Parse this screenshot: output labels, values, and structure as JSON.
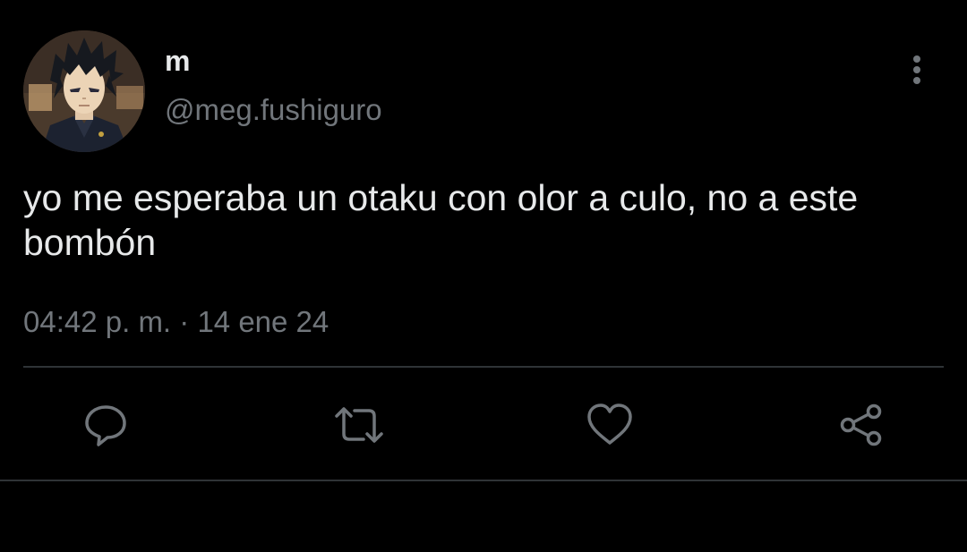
{
  "tweet": {
    "display_name": "m",
    "handle": "@meg.fushiguro",
    "text": "yo me esperaba un otaku con olor a culo, no a este bombón",
    "time": "04:42 p. m.",
    "separator": "·",
    "date": "14 ene 24"
  },
  "actions": {
    "reply_icon": "speech-bubble",
    "retweet_icon": "repeat-arrows",
    "like_icon": "heart",
    "share_icon": "share-nodes"
  },
  "menu_icon": "vertical-ellipsis",
  "colors": {
    "background": "#000000",
    "text_primary": "#e7e9ea",
    "text_secondary": "#71767b",
    "divider": "#2f3336"
  }
}
